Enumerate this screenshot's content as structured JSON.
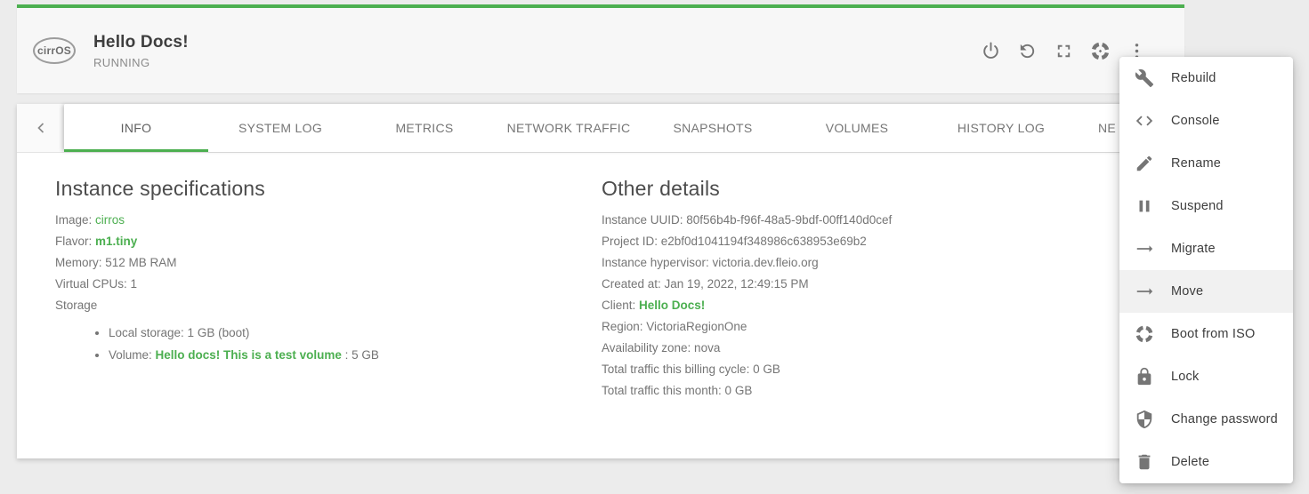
{
  "colors": {
    "accent": "#4caf50",
    "icon_gray": "#757575"
  },
  "header": {
    "logo": "cirrOS",
    "title": "Hello Docs!",
    "status": "RUNNING"
  },
  "tabs": [
    "INFO",
    "SYSTEM LOG",
    "METRICS",
    "NETWORK TRAFFIC",
    "SNAPSHOTS",
    "VOLUMES",
    "HISTORY LOG",
    "NE"
  ],
  "instance_specs": {
    "title": "Instance specifications",
    "image_label": "Image:",
    "image_link": "cirros",
    "flavor_label": "Flavor:",
    "flavor_link": "m1.tiny",
    "memory": "Memory: 512 MB RAM",
    "vcpus": "Virtual CPUs: 1",
    "storage_label": "Storage",
    "local_storage": "Local storage: 1 GB (boot)",
    "volume_label": "Volume:",
    "volume_link": "Hello docs! This is a test volume",
    "volume_suffix": ": 5 GB"
  },
  "other_details": {
    "title": "Other details",
    "uuid": "Instance UUID: 80f56b4b-f96f-48a5-9bdf-00ff140d0cef",
    "project": "Project ID: e2bf0d1041194f348986c638953e69b2",
    "hypervisor": "Instance hypervisor: victoria.dev.fleio.org",
    "created": "Created at: Jan 19, 2022, 12:49:15 PM",
    "client_label": "Client:",
    "client_link": "Hello Docs!",
    "region": "Region: VictoriaRegionOne",
    "az": "Availability zone: nova",
    "traffic_cycle": "Total traffic this billing cycle: 0 GB",
    "traffic_month": "Total traffic this month: 0 GB"
  },
  "menu": {
    "items": [
      {
        "icon": "wrench-icon",
        "label": "Rebuild"
      },
      {
        "icon": "code-icon",
        "label": "Console"
      },
      {
        "icon": "pencil-icon",
        "label": "Rename"
      },
      {
        "icon": "pause-icon",
        "label": "Suspend"
      },
      {
        "icon": "arrow-right-icon",
        "label": "Migrate"
      },
      {
        "icon": "arrow-right-icon",
        "label": "Move",
        "highlighted": true
      },
      {
        "icon": "boot-iso-icon",
        "label": "Boot from ISO"
      },
      {
        "icon": "lock-icon",
        "label": "Lock"
      },
      {
        "icon": "shield-icon",
        "label": "Change password"
      },
      {
        "icon": "trash-icon",
        "label": "Delete"
      }
    ]
  }
}
